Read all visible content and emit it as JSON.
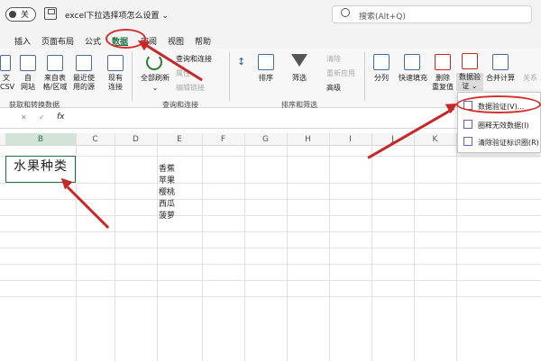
{
  "titlebar": {
    "toggle_label": "关",
    "doc_title": "excel下拉选择项怎么设置 ⌄",
    "search_placeholder": "搜索(Alt+Q)"
  },
  "tabs": [
    "插入",
    "页面布局",
    "公式",
    "数据",
    "审阅",
    "视图",
    "帮助"
  ],
  "ribbon": {
    "get_data": {
      "buttons": [
        {
          "label1": "文",
          "label2": "CSV"
        },
        {
          "label1": "自",
          "label2": "网站"
        },
        {
          "label1": "来自表",
          "label2": "格/区域"
        },
        {
          "label1": "最近使",
          "label2": "用的源"
        },
        {
          "label1": "现有",
          "label2": "连接"
        }
      ],
      "group_name": "获取和转换数据"
    },
    "queries": {
      "refresh_label": "全部刷新",
      "items": [
        "查询和连接",
        "属性",
        "编辑链接"
      ],
      "group_name": "查询和连接"
    },
    "sort_filter": {
      "sort_label": "排序",
      "filter_label": "筛选",
      "items": [
        "清除",
        "重新应用",
        "高级"
      ],
      "group_name": "排序和筛选"
    },
    "data_tools": {
      "buttons": [
        "分列",
        "快速填充",
        "删除",
        "重复值"
      ],
      "dv_label1": "数据验",
      "dv_label2": "证 ⌄",
      "consolidate": "合并计算",
      "relations": "关系"
    }
  },
  "formula_bar": {
    "cancel": "✕",
    "confirm": "✓",
    "fx": "fx"
  },
  "columns": [
    "B",
    "C",
    "D",
    "E",
    "F",
    "G",
    "H",
    "I",
    "J",
    "K"
  ],
  "cell_b2": "水果种类",
  "fruits": [
    "香蕉",
    "苹果",
    "樱桃",
    "西瓜",
    "菠萝"
  ],
  "dropdown": {
    "items": [
      "数据验证(V)...",
      "圈释无效数据(I)",
      "清除验证标识圈(R)"
    ]
  },
  "colors": {
    "accent": "#217346",
    "annotation": "#d32f2f"
  }
}
